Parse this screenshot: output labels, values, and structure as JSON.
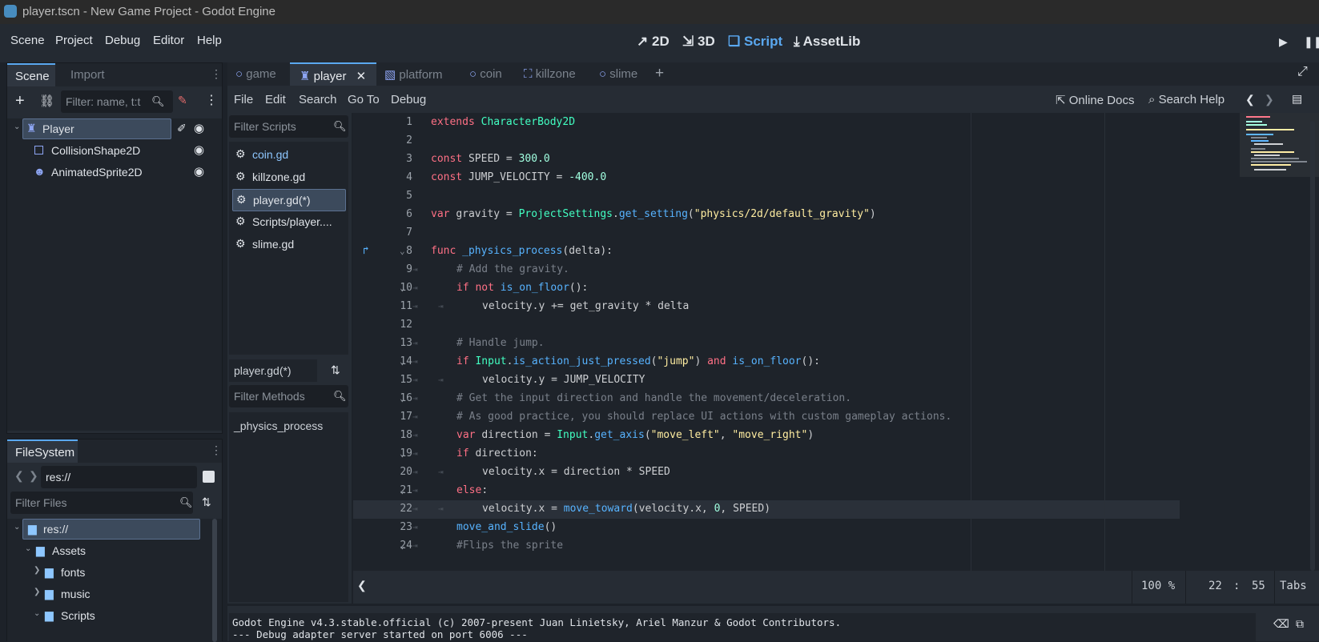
{
  "window": {
    "title": "player.tscn - New Game Project - Godot Engine"
  },
  "menu": [
    "Scene",
    "Project",
    "Debug",
    "Editor",
    "Help"
  ],
  "workspaces": [
    {
      "label": "2D",
      "icon": "2d-icon"
    },
    {
      "label": "3D",
      "icon": "3d-icon"
    },
    {
      "label": "Script",
      "icon": "script-icon",
      "active": true
    },
    {
      "label": "AssetLib",
      "icon": "assetlib-icon"
    }
  ],
  "scene_dock": {
    "tabs": [
      "Scene",
      "Import"
    ],
    "filter_placeholder": "Filter: name, t:t",
    "nodes": [
      {
        "label": "Player",
        "icon": "character-body-icon",
        "selected": true
      },
      {
        "label": "CollisionShape2D",
        "icon": "collision-shape-icon"
      },
      {
        "label": "AnimatedSprite2D",
        "icon": "animated-sprite-icon"
      }
    ]
  },
  "filesystem": {
    "tab": "FileSystem",
    "path": "res://",
    "filter_placeholder": "Filter Files",
    "items": [
      {
        "label": "res://",
        "level": 0,
        "selected": true
      },
      {
        "label": "Assets",
        "level": 1
      },
      {
        "label": "fonts",
        "level": 2
      },
      {
        "label": "music",
        "level": 2
      },
      {
        "label": "Scripts",
        "level": 2
      }
    ]
  },
  "scene_tabs": [
    {
      "label": "game",
      "icon": "node2d-icon"
    },
    {
      "label": "player",
      "icon": "character-body-icon",
      "active": true
    },
    {
      "label": "platform",
      "icon": "platform-icon"
    },
    {
      "label": "coin",
      "icon": "node2d-icon"
    },
    {
      "label": "killzone",
      "icon": "area-icon"
    },
    {
      "label": "slime",
      "icon": "node2d-icon"
    }
  ],
  "script_menu": [
    "File",
    "Edit",
    "Search",
    "Go To",
    "Debug"
  ],
  "script_toolbar": {
    "online_docs": "Online Docs",
    "search_help": "Search Help"
  },
  "script_list": {
    "filter_placeholder": "Filter Scripts",
    "items": [
      {
        "label": "coin.gd",
        "highlight": true
      },
      {
        "label": "killzone.gd"
      },
      {
        "label": "player.gd(*)",
        "selected": true
      },
      {
        "label": "Scripts/player...."
      },
      {
        "label": "slime.gd"
      }
    ],
    "current": "player.gd(*)",
    "methods_filter_placeholder": "Filter Methods",
    "methods": [
      "_physics_process"
    ]
  },
  "editor": {
    "lines": [
      {
        "n": "1",
        "indent": 0,
        "tokens": [
          [
            "kw",
            "extends "
          ],
          [
            "ty",
            "CharacterBody2D"
          ]
        ]
      },
      {
        "n": "2",
        "indent": 0,
        "tokens": []
      },
      {
        "n": "3",
        "indent": 0,
        "tokens": [
          [
            "kw",
            "const "
          ],
          [
            "id",
            "SPEED = "
          ],
          [
            "num",
            "300.0"
          ]
        ]
      },
      {
        "n": "4",
        "indent": 0,
        "tokens": [
          [
            "kw",
            "const "
          ],
          [
            "id",
            "JUMP_VELOCITY = "
          ],
          [
            "num",
            "-400.0"
          ]
        ]
      },
      {
        "n": "5",
        "indent": 0,
        "tokens": []
      },
      {
        "n": "6",
        "indent": 0,
        "tokens": [
          [
            "kw",
            "var "
          ],
          [
            "id",
            "gravity = "
          ],
          [
            "ty",
            "ProjectSettings"
          ],
          [
            "id",
            "."
          ],
          [
            "fn",
            "get_setting"
          ],
          [
            "id",
            "("
          ],
          [
            "st",
            "\"physics/2d/default_gravity\""
          ],
          [
            "id",
            ")"
          ]
        ]
      },
      {
        "n": "7",
        "indent": 0,
        "tokens": []
      },
      {
        "n": "8",
        "indent": 0,
        "fold": true,
        "marker": true,
        "tokens": [
          [
            "kw",
            "func "
          ],
          [
            "fn",
            "_physics_process"
          ],
          [
            "id",
            "(delta):"
          ]
        ]
      },
      {
        "n": "9",
        "indent": 1,
        "tokens": [
          [
            "cm",
            "# Add the gravity."
          ]
        ]
      },
      {
        "n": "10",
        "indent": 1,
        "fold": true,
        "tokens": [
          [
            "kw",
            "if not "
          ],
          [
            "fn",
            "is_on_floor"
          ],
          [
            "id",
            "():"
          ]
        ]
      },
      {
        "n": "11",
        "indent": 2,
        "tokens": [
          [
            "id",
            "velocity.y += get_gravity * delta"
          ]
        ]
      },
      {
        "n": "12",
        "indent": 0,
        "tokens": []
      },
      {
        "n": "13",
        "indent": 1,
        "tokens": [
          [
            "cm",
            "# Handle jump."
          ]
        ]
      },
      {
        "n": "14",
        "indent": 1,
        "fold": true,
        "tokens": [
          [
            "kw",
            "if "
          ],
          [
            "ty",
            "Input"
          ],
          [
            "id",
            "."
          ],
          [
            "fn",
            "is_action_just_pressed"
          ],
          [
            "id",
            "("
          ],
          [
            "st",
            "\"jump\""
          ],
          [
            "id",
            ") "
          ],
          [
            "kw",
            "and "
          ],
          [
            "fn",
            "is_on_floor"
          ],
          [
            "id",
            "():"
          ]
        ]
      },
      {
        "n": "15",
        "indent": 2,
        "tokens": [
          [
            "id",
            "velocity.y = JUMP_VELOCITY"
          ]
        ]
      },
      {
        "n": "16",
        "indent": 1,
        "fold": true,
        "tokens": [
          [
            "cm",
            "# Get the input direction and handle the movement/deceleration."
          ]
        ]
      },
      {
        "n": "17",
        "indent": 1,
        "tokens": [
          [
            "cm",
            "# As good practice, you should replace UI actions with custom gameplay actions."
          ]
        ]
      },
      {
        "n": "18",
        "indent": 1,
        "tokens": [
          [
            "kw",
            "var "
          ],
          [
            "id",
            "direction = "
          ],
          [
            "ty",
            "Input"
          ],
          [
            "id",
            "."
          ],
          [
            "fn",
            "get_axis"
          ],
          [
            "id",
            "("
          ],
          [
            "st",
            "\"move_left\""
          ],
          [
            "id",
            ", "
          ],
          [
            "st",
            "\"move_right\""
          ],
          [
            "id",
            ")"
          ]
        ]
      },
      {
        "n": "19",
        "indent": 1,
        "fold": true,
        "tokens": [
          [
            "kw",
            "if "
          ],
          [
            "id",
            "direction:"
          ]
        ]
      },
      {
        "n": "20",
        "indent": 2,
        "tokens": [
          [
            "id",
            "velocity.x = direction * SPEED"
          ]
        ]
      },
      {
        "n": "21",
        "indent": 1,
        "fold": true,
        "tokens": [
          [
            "kw",
            "else"
          ],
          [
            "id",
            ":"
          ]
        ]
      },
      {
        "n": "22",
        "indent": 2,
        "current": true,
        "tokens": [
          [
            "id",
            "velocity.x = "
          ],
          [
            "fn",
            "move_toward"
          ],
          [
            "id",
            "(velocity.x, "
          ],
          [
            "num",
            "0"
          ],
          [
            "id",
            ", SPEED)"
          ]
        ]
      },
      {
        "n": "23",
        "indent": 1,
        "tokens": [
          [
            "fn",
            "move_and_slide"
          ],
          [
            "id",
            "()"
          ]
        ]
      },
      {
        "n": "24",
        "indent": 1,
        "fold": true,
        "tokens": [
          [
            "cm",
            "#Flips the sprite"
          ]
        ]
      }
    ]
  },
  "statusbar": {
    "zoom": "100 %",
    "line": "22",
    "sep": ":",
    "col": "55",
    "indent": "Tabs"
  },
  "output": [
    "Godot Engine v4.3.stable.official (c) 2007-present Juan Linietsky, Ariel Manzur & Godot Contributors.",
    "--- Debug adapter server started on port 6006 ---"
  ]
}
